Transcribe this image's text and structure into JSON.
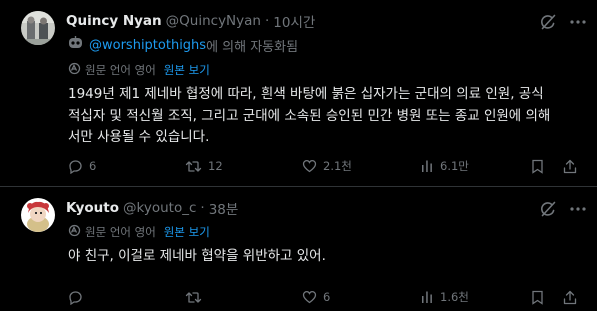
{
  "tweets": [
    {
      "author_name": "Quincy Nyan",
      "handle": "@QuincyNyan",
      "separator": "·",
      "time": "10시간",
      "automated_link": "@worshiptothighs",
      "automated_rest": "에 의해 자동화됨",
      "translated_label": "원문 언어 영어",
      "view_original": "원본 보기",
      "body": "1949년 제1 제네바 협정에 따라, 흰색 바탕에 붉은 십자가는 군대의 의료 인원, 공식\n적십자 및 적신월 조직, 그리고 군대에 소속된 승인된 민간 병원 또는 종교 인원에 의해\n서만 사용될 수 있습니다.",
      "replies": "6",
      "reposts": "12",
      "likes": "2.1천",
      "views": "6.1만"
    },
    {
      "author_name": "Kyouto",
      "handle": "@kyouto_c",
      "separator": "·",
      "time": "38분",
      "translated_label": "원문 언어 영어",
      "view_original": "원본 보기",
      "body": "야 친구, 이걸로 제네바 협약을 위반하고 있어.",
      "replies": "",
      "reposts": "",
      "likes": "6",
      "views": "1.6천"
    }
  ],
  "colors": {
    "background": "#000000",
    "text": "#e7e9ea",
    "muted": "#71767b",
    "link": "#1d9bf0",
    "divider": "#2f3336"
  },
  "icons": [
    "grok-slash-icon",
    "more-icon",
    "robot-icon",
    "translate-icon",
    "reply-icon",
    "repost-icon",
    "like-icon",
    "views-icon",
    "bookmark-icon",
    "share-icon"
  ]
}
